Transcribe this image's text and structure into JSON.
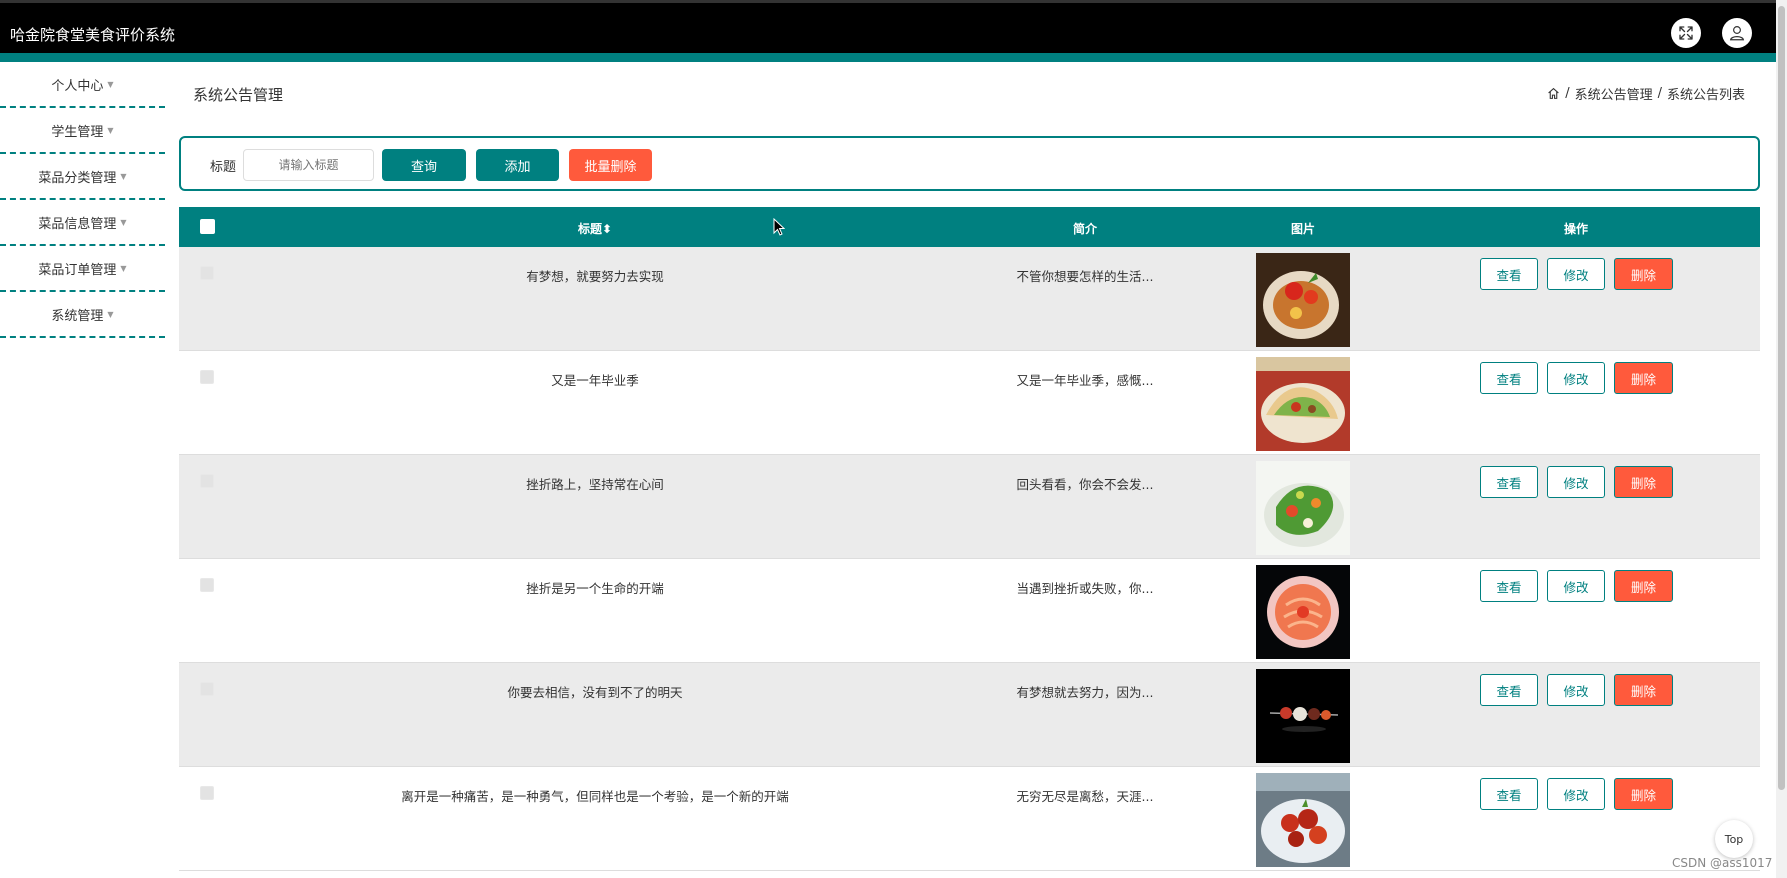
{
  "app": {
    "title": "哈金院食堂美食评价系统"
  },
  "header": {
    "fullscreen_icon": "expand-icon",
    "user_icon": "user-icon"
  },
  "sidebar": {
    "items": [
      {
        "label": "个人中心"
      },
      {
        "label": "学生管理"
      },
      {
        "label": "菜品分类管理"
      },
      {
        "label": "菜品信息管理"
      },
      {
        "label": "菜品订单管理"
      },
      {
        "label": "系统管理"
      }
    ]
  },
  "page": {
    "title": "系统公告管理",
    "breadcrumb": [
      "系统公告管理",
      "系统公告列表"
    ],
    "breadcrumb_sep": "/"
  },
  "search": {
    "label": "标题",
    "placeholder": "请输入标题",
    "query_label": "查询",
    "add_label": "添加",
    "batch_delete_label": "批量删除"
  },
  "table": {
    "headers": {
      "title": "标题",
      "sort_arrow": "⬍",
      "intro": "简介",
      "image": "图片",
      "actions": "操作"
    },
    "action_labels": {
      "view": "查看",
      "edit": "修改",
      "delete": "删除"
    },
    "rows": [
      {
        "title": "有梦想，就要努力去实现",
        "intro": "不管你想要怎样的生活..."
      },
      {
        "title": "又是一年毕业季",
        "intro": "又是一年毕业季，感慨..."
      },
      {
        "title": "挫折路上，坚持常在心间",
        "intro": "回头看看，你会不会发..."
      },
      {
        "title": "挫折是另一个生命的开端",
        "intro": "当遇到挫折或失败，你..."
      },
      {
        "title": "你要去相信，没有到不了的明天",
        "intro": "有梦想就去努力，因为..."
      },
      {
        "title": "离开是一种痛苦，是一种勇气，但同样也是一个考验，是一个新的开端",
        "intro": "无穷无尽是离愁，天涯..."
      }
    ]
  },
  "top_button": {
    "label": "Top"
  },
  "watermark": "CSDN @ass1017",
  "colors": {
    "primary": "#008080",
    "danger": "#ff5a3c",
    "header": "#000000"
  }
}
